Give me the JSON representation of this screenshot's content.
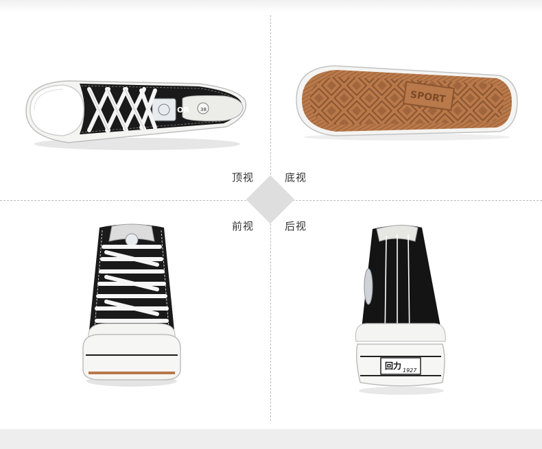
{
  "views": {
    "top": "顶视",
    "bottom": "底视",
    "front": "前视",
    "back": "后视"
  },
  "sole": {
    "text": "SPORT"
  },
  "heel_badge": {
    "brand": "回力",
    "year": "1927"
  },
  "side_logo": {
    "text": "OR"
  },
  "colors": {
    "canvas": "#1a1a1a",
    "rubber": "#f4f4f2",
    "outsole": "#b9794a",
    "outsole_dark": "#8a5530",
    "divider": "#b9b9b9",
    "diamond": "#dedede"
  }
}
